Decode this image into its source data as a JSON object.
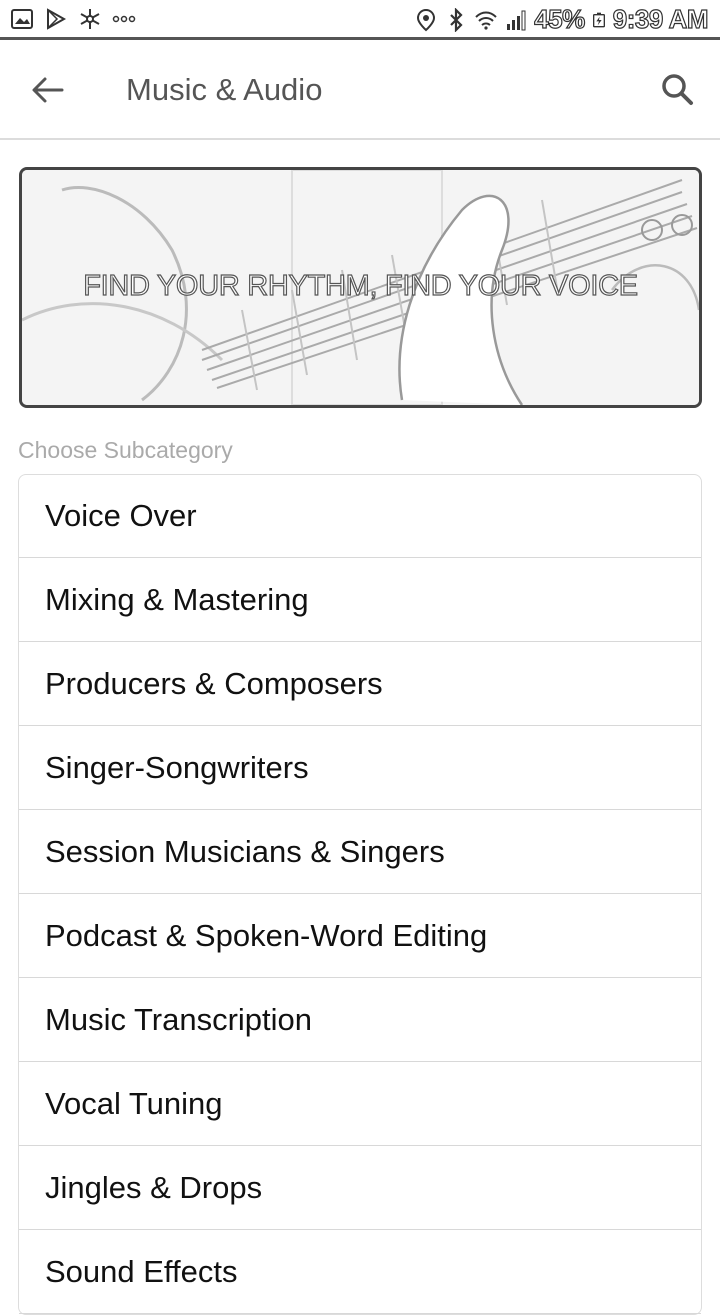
{
  "status_bar": {
    "battery": "45%",
    "time": "9:39 AM",
    "icons_left": [
      "gallery-icon",
      "play-store-icon",
      "snowflake-icon",
      "more-notifications-icon"
    ],
    "icons_right": [
      "location-icon",
      "bluetooth-icon",
      "wifi-icon",
      "signal-icon",
      "battery-icon"
    ]
  },
  "header": {
    "title": "Music & Audio",
    "back_icon": "arrow-left-icon",
    "search_icon": "search-icon"
  },
  "banner": {
    "text": "FIND YOUR RHYTHM, FIND YOUR VOICE"
  },
  "section": {
    "label": "Choose Subcategory"
  },
  "subcategories": [
    "Voice Over",
    "Mixing & Mastering",
    "Producers & Composers",
    "Singer-Songwriters",
    "Session Musicians & Singers",
    "Podcast & Spoken-Word Editing",
    "Music Transcription",
    "Vocal Tuning",
    "Jingles & Drops",
    "Sound Effects"
  ],
  "colors": {
    "title": "#555555",
    "label": "#aaaaaa",
    "item_text": "#111111",
    "divider": "#d8d8d8"
  }
}
